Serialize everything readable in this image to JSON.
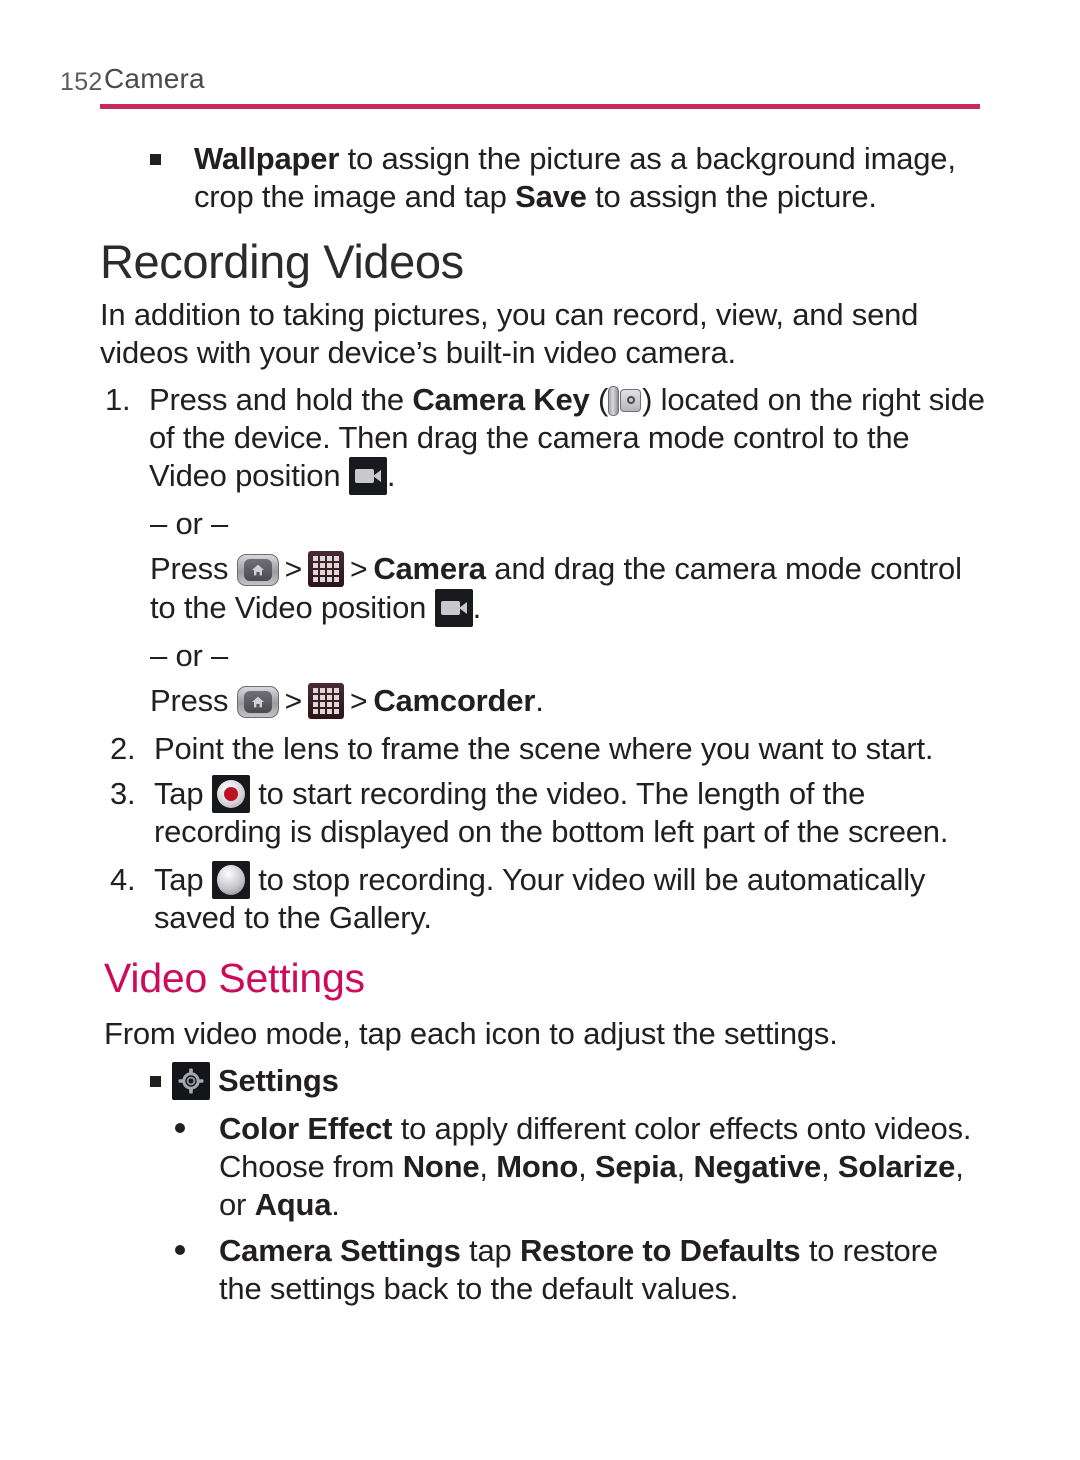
{
  "header": {
    "page_number": "152",
    "title": "Camera",
    "rule_color": "#c62a5e"
  },
  "wallpaper_bullet": {
    "bullet": "▪",
    "line1_bold": "Wallpaper",
    "line1_rest": " to assign the picture as a background image,",
    "line2_pre": "crop the image and tap ",
    "line2_bold": "Save",
    "line2_rest": " to assign the picture."
  },
  "section": {
    "heading": "Recording Videos",
    "intro": "In addition to taking pictures, you can record, view, and send videos with your device’s built-in video camera."
  },
  "steps": {
    "step1": {
      "marker": "1.",
      "pre": "Press and hold the ",
      "bold": "Camera Key",
      "paren_open": "(",
      "camera_key_icon": "camera-key-icon",
      "paren_close": ")",
      "mid": " located on the right side of the device. Then drag the camera mode control to the Video position ",
      "video_icon": "video-position-icon",
      "post": "."
    },
    "or_1": "– or –",
    "alt1": {
      "pre": "Press ",
      "home_icon": "home-key-icon",
      "arrow1": ">",
      "apps_icon": "apps-grid-icon",
      "arrow2": ">",
      "bold": "Camera",
      "mid": " and drag the camera mode control to the Video position ",
      "video_icon": "video-position-icon",
      "post": "."
    },
    "or_2": "– or –",
    "alt2": {
      "pre": "Press ",
      "home_icon": "home-key-icon",
      "arrow1": ">",
      "apps_icon": "apps-grid-icon",
      "arrow2": ">",
      "bold": "Camcorder",
      "post": "."
    },
    "step2": {
      "marker": "2.",
      "text": "Point the lens to frame the scene where you want to start."
    },
    "step3": {
      "marker": "3.",
      "pre": "Tap ",
      "record_icon": "record-button-icon",
      "post": " to start recording the video. The length of the recording is displayed on the bottom left part of the screen."
    },
    "step4": {
      "marker": "4.",
      "pre": "Tap ",
      "stop_icon": "stop-button-icon",
      "post": " to stop recording. Your video will be automatically saved to the Gallery."
    }
  },
  "video_settings": {
    "heading": "Video Settings",
    "heading_color": "#cc0b5a",
    "intro": "From video mode, tap each icon to adjust the settings.",
    "settings_bullet": {
      "bullet": "▪",
      "gear_icon": "settings-gear-icon",
      "label": "Settings"
    },
    "items": [
      {
        "bullet": "•",
        "bold1": "Color Effect",
        "text1": " to apply different color effects onto videos. Choose from ",
        "options": [
          "None",
          "Mono",
          "Sepia",
          "Negative",
          "Solarize",
          "Aqua"
        ],
        "text_choose_tail": ", or ",
        "text_end": "."
      },
      {
        "bullet": "•",
        "bold1": "Camera Settings",
        "text1": " tap ",
        "bold2": "Restore to Defaults",
        "text2": " to restore the settings back to the default values."
      }
    ]
  }
}
